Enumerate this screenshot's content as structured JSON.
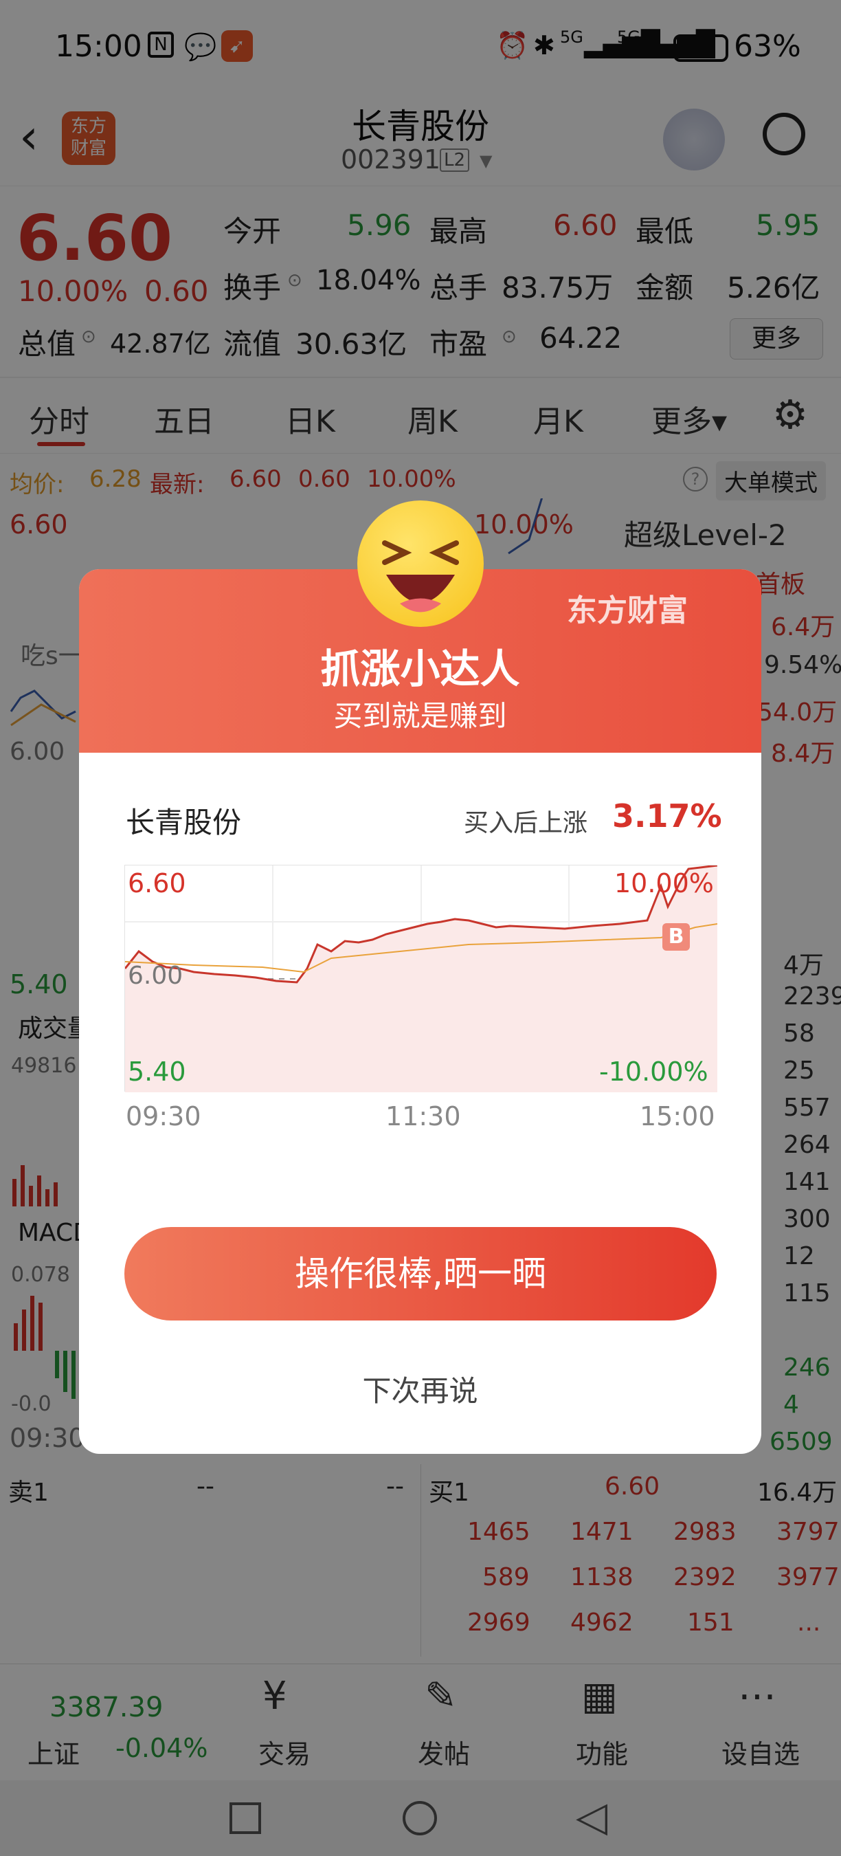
{
  "status_bar": {
    "time": "15:00",
    "battery": "63%",
    "signal_a": "5G",
    "signal_b": "5G"
  },
  "header": {
    "title": "长青股份",
    "code": "002391",
    "level": "L2",
    "brand_logo": "东方\n财富"
  },
  "quote": {
    "price": "6.60",
    "change_pct": "10.00%",
    "change": "0.60",
    "cells": [
      {
        "label": "今开",
        "value": "5.96",
        "color": "green"
      },
      {
        "label": "最高",
        "value": "6.60",
        "color": "red"
      },
      {
        "label": "最低",
        "value": "5.95",
        "color": "green"
      },
      {
        "label": "换手",
        "value": "18.04%",
        "color": "dark"
      },
      {
        "label": "总手",
        "value": "83.75万",
        "color": "dark"
      },
      {
        "label": "金额",
        "value": "5.26亿",
        "color": "dark"
      },
      {
        "label": "总值",
        "value": "42.87亿",
        "color": "dark"
      },
      {
        "label": "流值",
        "value": "30.63亿",
        "color": "dark"
      },
      {
        "label": "市盈",
        "value": "64.22",
        "color": "dark"
      }
    ],
    "more_button": "更多"
  },
  "tabs": [
    "分时",
    "五日",
    "日K",
    "周K",
    "月K",
    "更多▾"
  ],
  "info_bar": {
    "avg_label": "均价:",
    "avg_value": "6.28",
    "latest_label": "最新:",
    "latest_price": "6.60",
    "latest_change": "0.60",
    "latest_pct": "10.00%",
    "mode_button": "大单模式"
  },
  "background_chart": {
    "top_price": "6.60",
    "top_pct": "10.00%",
    "mid_price": "6.00",
    "bottom_price": "5.40",
    "vol_label": "成交量",
    "vol_value": "49816",
    "macd_label": "MACD",
    "macd_top": "0.078",
    "macd_bottom": "-0.0",
    "time_start": "09:30",
    "snack": "吃s一"
  },
  "level2": {
    "title": "超级Level-2",
    "rows": [
      "首板",
      "6.4万",
      "9.54%",
      "54.0万",
      "8.4万"
    ],
    "lower": [
      "4万",
      "2239",
      "58",
      "25",
      "557",
      "264",
      "141",
      "300",
      "12",
      "115",
      "246",
      "4",
      "6509"
    ]
  },
  "orderbook": {
    "sell1_label": "卖1",
    "sell1_price": "--",
    "sell1_vol": "--",
    "buy1_label": "买1",
    "buy1_price": "6.60",
    "buy1_vol": "16.4万",
    "rows": [
      [
        "1465",
        "1471",
        "2983",
        "3797"
      ],
      [
        "589",
        "1138",
        "2392",
        "3977"
      ],
      [
        "2969",
        "4962",
        "151",
        "..."
      ]
    ]
  },
  "bottom_nav": {
    "index_value": "3387.39",
    "index_name": "上证",
    "index_change": "-0.04%",
    "items": [
      "交易",
      "发帖",
      "功能",
      "设自选"
    ]
  },
  "modal": {
    "brand": "东方财富",
    "title": "抓涨小达人",
    "subtitle": "买到就是赚到",
    "stock_name": "长青股份",
    "gain_label": "买入后上涨",
    "gain_value": "3.17%",
    "chart_top_left": "6.60",
    "chart_top_right": "10.00%",
    "chart_mid": "6.00",
    "chart_bottom_left": "5.40",
    "chart_bottom_right": "-10.00%",
    "times": [
      "09:30",
      "11:30",
      "15:00"
    ],
    "buy_marker": "B",
    "share_button": "操作很棒,晒一晒",
    "later_link": "下次再说"
  },
  "colors": {
    "accent": "#e8503e",
    "up": "#d6332a",
    "down": "#2a9a3c",
    "avg_line": "#e9a23b"
  }
}
